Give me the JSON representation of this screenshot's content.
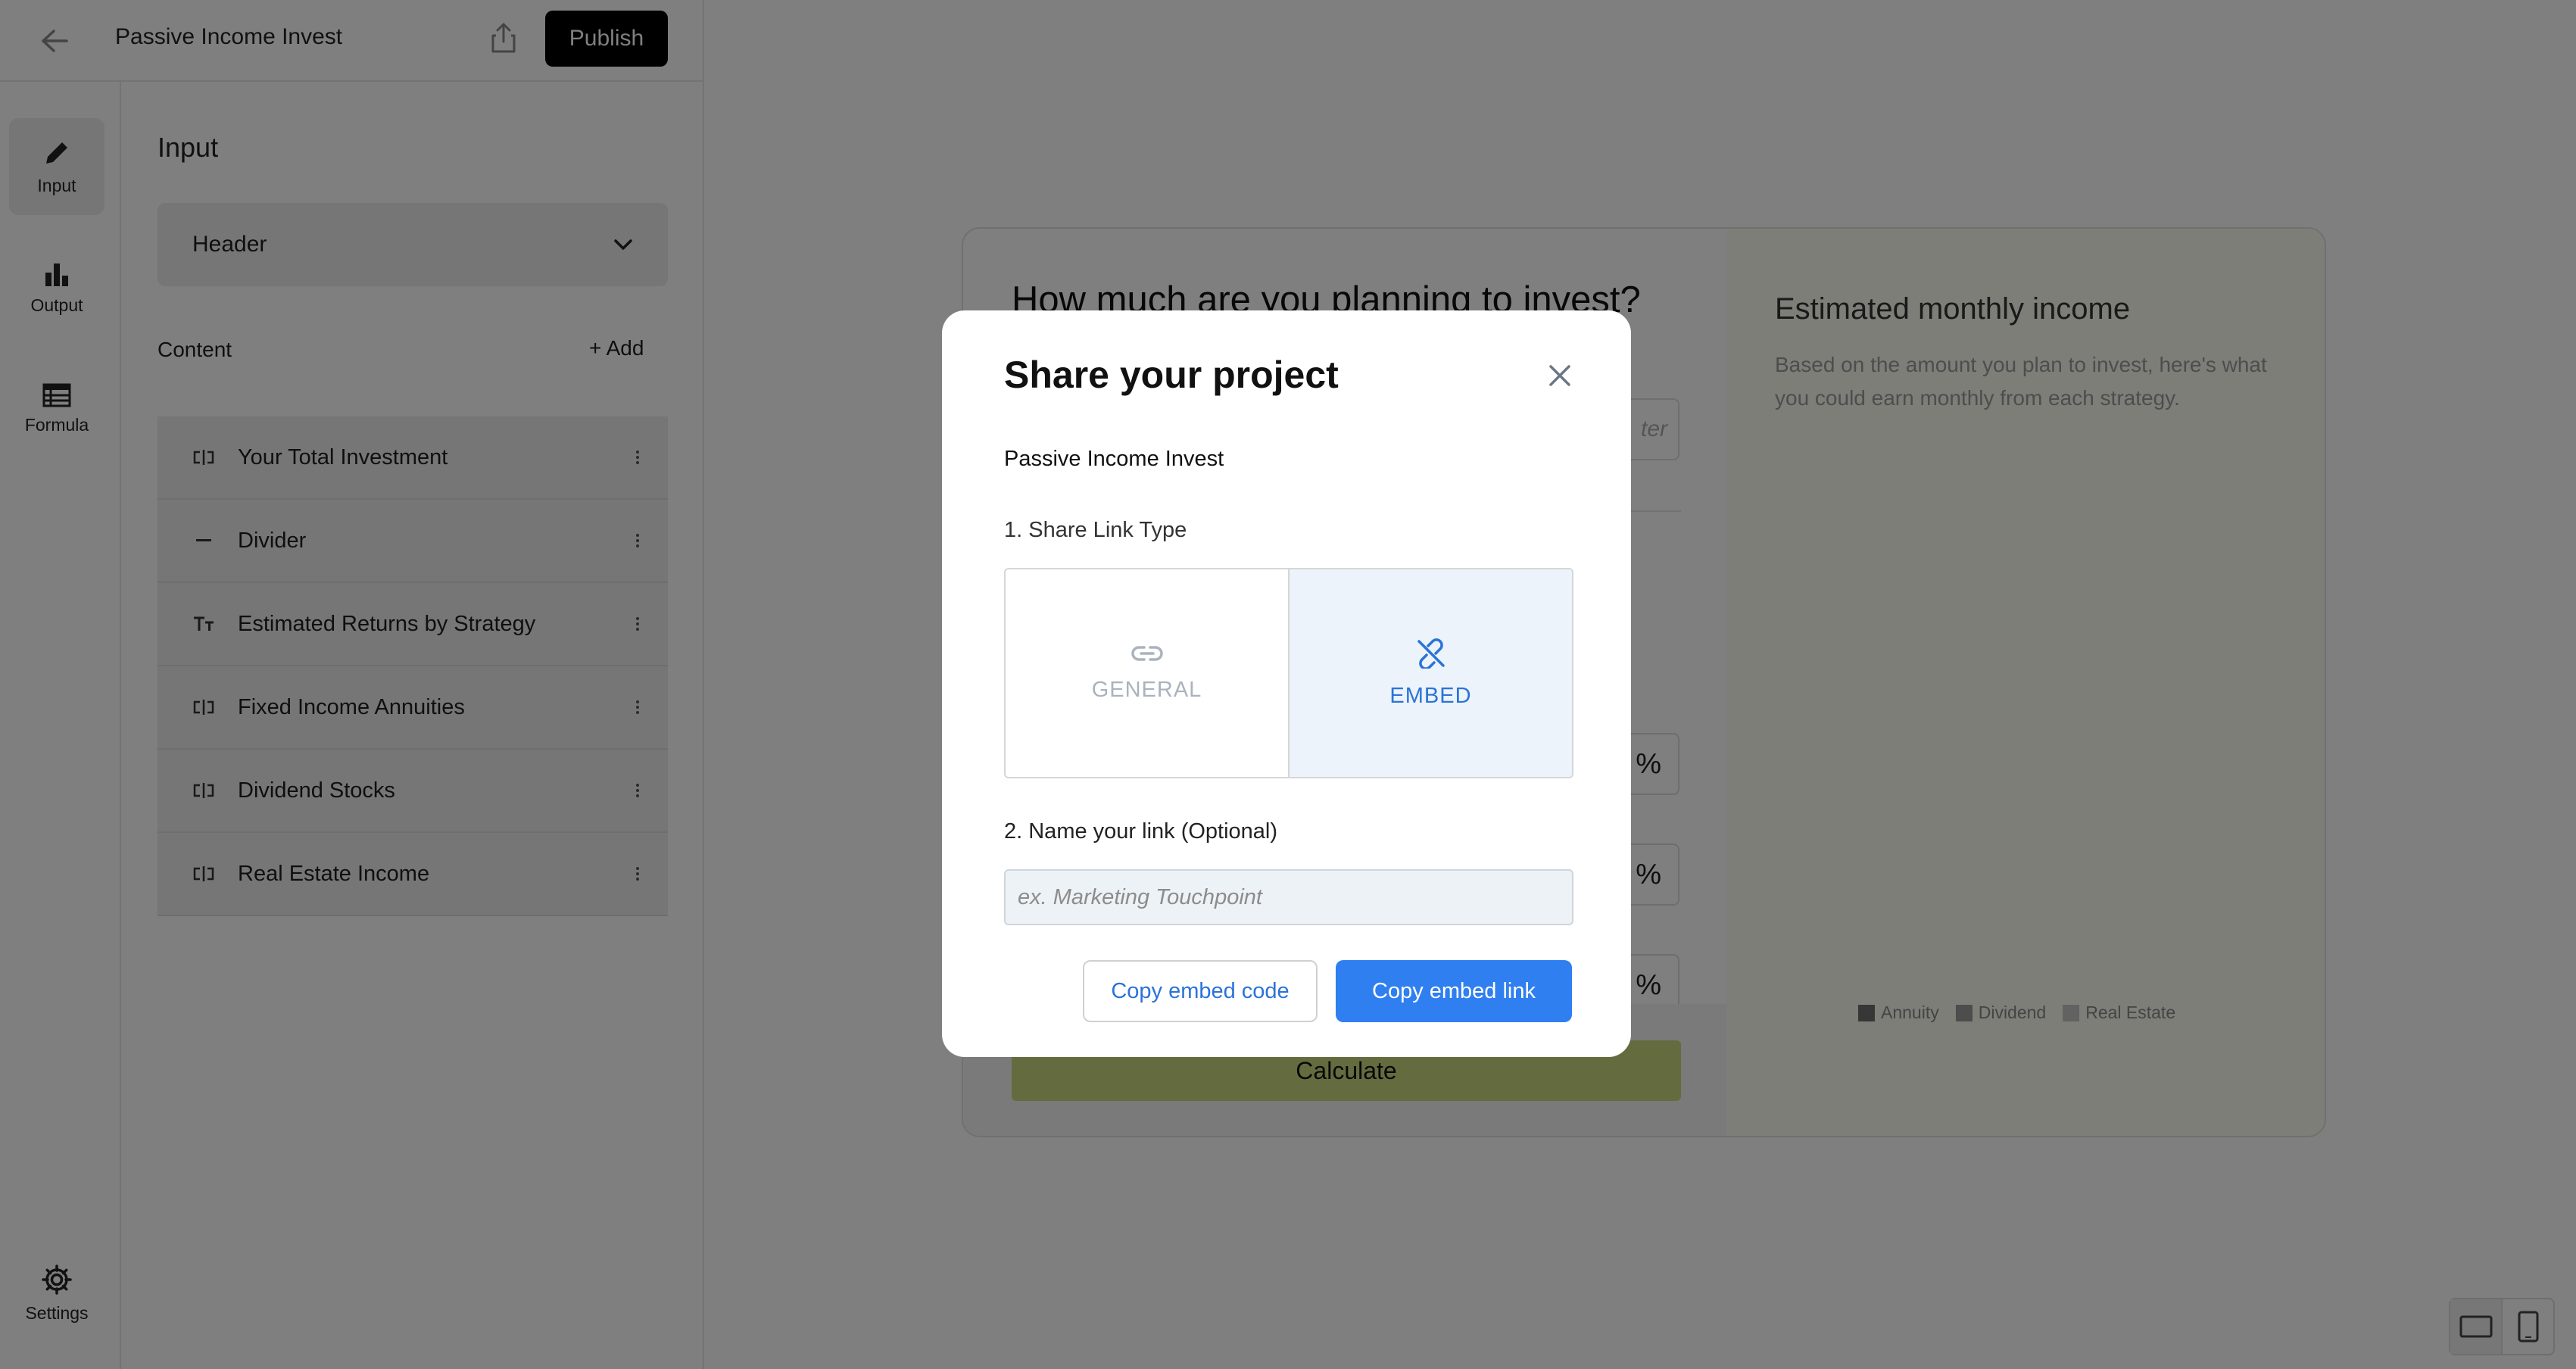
{
  "header": {
    "project_title": "Passive Income Invest",
    "publish_label": "Publish"
  },
  "rail": {
    "items": [
      {
        "label": "Input",
        "icon": "pencil-icon",
        "active": true
      },
      {
        "label": "Output",
        "icon": "bar-chart-icon",
        "active": false
      },
      {
        "label": "Formula",
        "icon": "table-icon",
        "active": false
      }
    ],
    "settings_label": "Settings"
  },
  "panel": {
    "title": "Input",
    "header_select": "Header",
    "content_label": "Content",
    "add_label": "+ Add",
    "items": [
      {
        "label": "Your Total Investment",
        "icon": "slider-input-icon"
      },
      {
        "label": "Divider",
        "icon": "divider-icon"
      },
      {
        "label": "Estimated Returns by Strategy",
        "icon": "text-icon"
      },
      {
        "label": "Fixed Income Annuities",
        "icon": "slider-input-icon"
      },
      {
        "label": "Dividend Stocks",
        "icon": "slider-input-icon"
      },
      {
        "label": "Real Estate Income",
        "icon": "slider-input-icon"
      }
    ]
  },
  "preview": {
    "question_title": "How much are you planning to invest?",
    "invest_placeholder": "ter",
    "pct_symbol": "%",
    "calculate_label": "Calculate",
    "estimate_title": "Estimated monthly income",
    "estimate_desc": "Based on the amount you plan to invest, here's what you could earn monthly from each strategy.",
    "legend": [
      {
        "name": "Annuity",
        "color": "#6e6e6e"
      },
      {
        "name": "Dividend",
        "color": "#9a9a9a"
      },
      {
        "name": "Real Estate",
        "color": "#c4c4c4"
      }
    ]
  },
  "modal": {
    "title": "Share your project",
    "project_name": "Passive Income Invest",
    "step1_label": "1. Share Link Type",
    "option_general": "GENERAL",
    "option_embed": "EMBED",
    "selected_option": "EMBED",
    "step2_label": "2. Name your link (Optional)",
    "link_placeholder": "ex. Marketing Touchpoint",
    "link_value": "",
    "copy_code_label": "Copy embed code",
    "copy_link_label": "Copy embed link",
    "accent_color": "#2f7ff0"
  }
}
